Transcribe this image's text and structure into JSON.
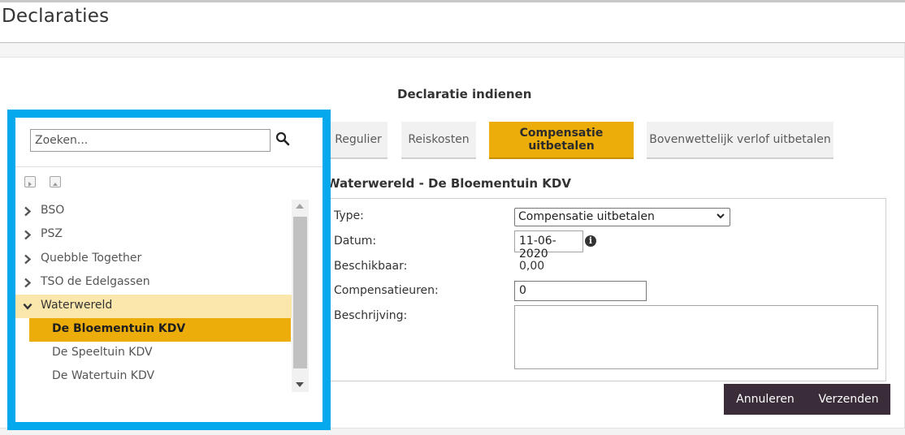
{
  "page": {
    "title": "Declaraties"
  },
  "form": {
    "heading": "Declaratie indienen",
    "tabs": [
      {
        "label": "Regulier",
        "active": false
      },
      {
        "label": "Reiskosten",
        "active": false
      },
      {
        "label": "Compensatie uitbetalen",
        "active": true
      },
      {
        "label": "Bovenwettelijk verlof uitbetalen",
        "active": false
      }
    ],
    "location": "Waterwereld - De Bloementuin KDV",
    "fields": {
      "type_label": "Type:",
      "type_value": "Compensatie uitbetalen",
      "datum_label": "Datum:",
      "datum_value": "11-06-2020",
      "beschikbaar_label": "Beschikbaar:",
      "beschikbaar_value": "0,00",
      "compensatieuren_label": "Compensatieuren:",
      "compensatieuren_value": "0",
      "beschrijving_label": "Beschrijving:",
      "beschrijving_value": ""
    },
    "buttons": {
      "cancel": "Annuleren",
      "submit": "Verzenden"
    }
  },
  "sidebar": {
    "search_placeholder": "Zoeken...",
    "tree": [
      {
        "label": "BSO",
        "expanded": false
      },
      {
        "label": "PSZ",
        "expanded": false
      },
      {
        "label": "Quebble Together",
        "expanded": false
      },
      {
        "label": "TSO de Edelgassen",
        "expanded": false
      },
      {
        "label": "Waterwereld",
        "expanded": true,
        "children": [
          {
            "label": "De Bloementuin KDV",
            "selected": true
          },
          {
            "label": "De Speeltuin KDV",
            "selected": false
          },
          {
            "label": "De Watertuin KDV",
            "selected": false
          }
        ]
      }
    ]
  },
  "colors": {
    "accent": "#ecad0b",
    "accent_light": "#fbe7ac",
    "highlight_border": "#04a9ed",
    "button_dark": "#3b2c39"
  },
  "icons": [
    "search-icon",
    "info-icon",
    "chevron-right-icon",
    "chevron-down-icon",
    "collapse-arrow-icon",
    "expand-all-icon",
    "collapse-all-icon"
  ]
}
